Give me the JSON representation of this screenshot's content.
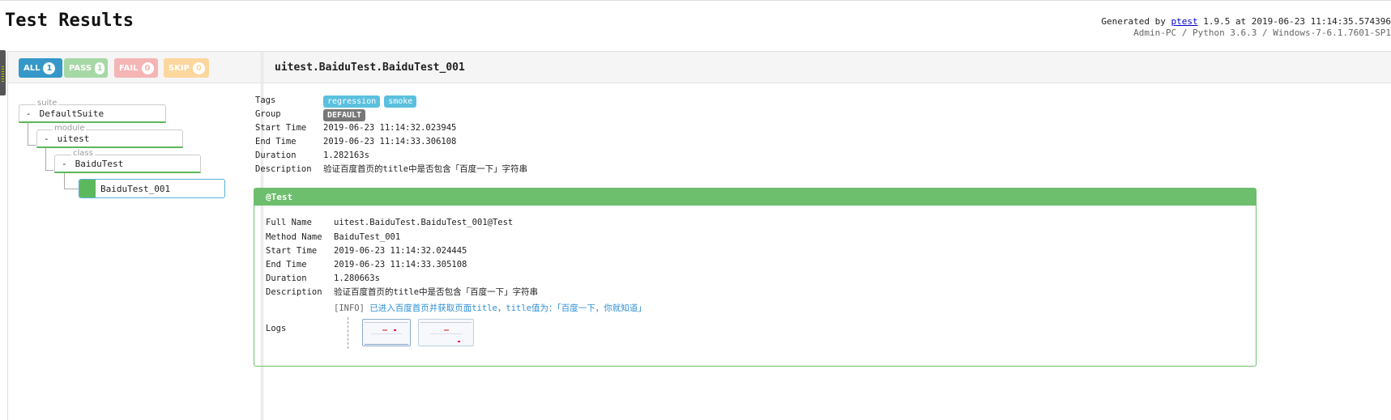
{
  "header": {
    "title": "Test Results",
    "generated_prefix": "Generated by",
    "tool_link": "ptest",
    "generated_suffix": "1.9.5 at 2019-06-23 11:14:35.574396",
    "environment": "Admin-PC / Python 3.6.3 / Windows-7-6.1.7601-SP1"
  },
  "filters": [
    {
      "label": "ALL",
      "count": "1"
    },
    {
      "label": "PASS",
      "count": "1"
    },
    {
      "label": "FAIL",
      "count": "0"
    },
    {
      "label": "SKIP",
      "count": "0"
    }
  ],
  "tree": {
    "suite_label": "suite",
    "suite_name": "DefaultSuite",
    "module_label": "module",
    "module_name": "uitest",
    "class_label": "class",
    "class_name": "BaiduTest",
    "test_name": "BaiduTest_001",
    "collapse_symbol": "-"
  },
  "detail": {
    "title": "uitest.BaiduTest.BaiduTest_001",
    "labels": {
      "tags": "Tags",
      "group": "Group",
      "start_time": "Start Time",
      "end_time": "End Time",
      "duration": "Duration",
      "description": "Description"
    },
    "tags": [
      "regression",
      "smoke"
    ],
    "group": "DEFAULT",
    "start_time": "2019-06-23 11:14:32.023945",
    "end_time": "2019-06-23 11:14:33.306108",
    "duration": "1.282163s",
    "description": "验证百度首页的title中是否包含「百度一下」字符串"
  },
  "test": {
    "header": "@Test",
    "labels": {
      "full_name": "Full Name",
      "method_name": "Method Name",
      "start_time": "Start Time",
      "end_time": "End Time",
      "duration": "Duration",
      "description": "Description",
      "logs": "Logs"
    },
    "full_name": "uitest.BaiduTest.BaiduTest_001@Test",
    "method_name": "BaiduTest_001",
    "start_time": "2019-06-23 11:14:32.024445",
    "end_time": "2019-06-23 11:14:33.305108",
    "duration": "1.280663s",
    "description": "验证百度首页的title中是否包含「百度一下」字符串",
    "log_level": "[INFO]",
    "log_message": "已进入百度首页并获取页面title，title值为：「百度一下，你就知道」"
  },
  "colors": {
    "pass": "#5cb85c",
    "test_header": "#6dbf6d",
    "all_button": "#3598c8",
    "tag": "#5bc0de",
    "link": "#0000cc"
  }
}
